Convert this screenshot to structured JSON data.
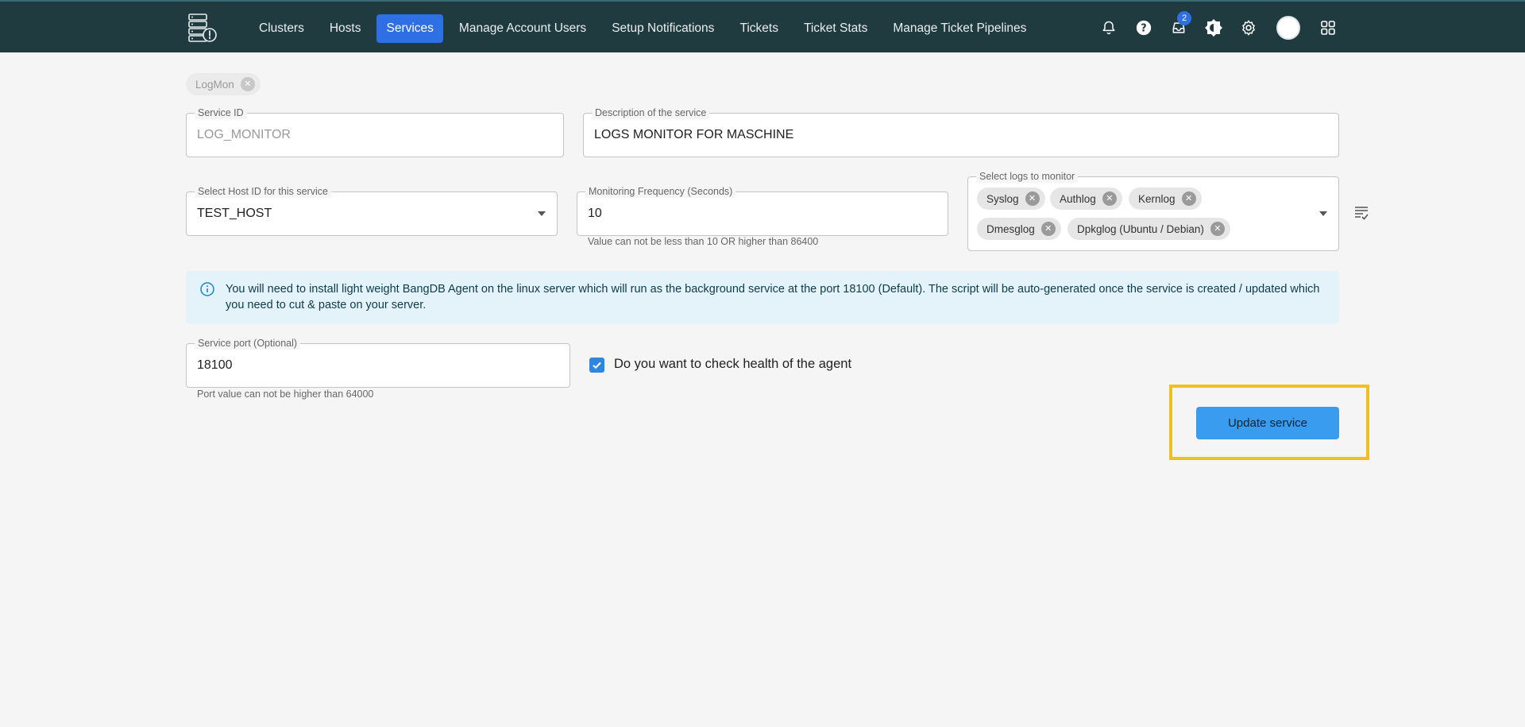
{
  "nav": {
    "items": [
      {
        "label": "Clusters"
      },
      {
        "label": "Hosts"
      },
      {
        "label": "Services"
      },
      {
        "label": "Manage Account Users"
      },
      {
        "label": "Setup Notifications"
      },
      {
        "label": "Tickets"
      },
      {
        "label": "Ticket Stats"
      },
      {
        "label": "Manage Ticket Pipelines"
      }
    ],
    "active": "Services",
    "inbox_badge": "2",
    "icons": [
      "bell-icon",
      "help-icon",
      "inbox-icon",
      "theme-icon",
      "gear-icon",
      "avatar",
      "apps-grid-icon"
    ]
  },
  "service_chip": {
    "label": "LogMon"
  },
  "form": {
    "service_id": {
      "label": "Service ID",
      "value": "LOG_MONITOR"
    },
    "description": {
      "label": "Description of the service",
      "value": "LOGS MONITOR FOR MASCHINE"
    },
    "host_id": {
      "label": "Select Host ID for this service",
      "value": "TEST_HOST"
    },
    "frequency": {
      "label": "Monitoring Frequency (Seconds)",
      "value": "10",
      "helper": "Value can not be less than 10 OR higher than 86400"
    },
    "logs": {
      "label": "Select logs to monitor",
      "selected": [
        "Syslog",
        "Authlog",
        "Kernlog",
        "Dmesglog",
        "Dpkglog (Ubuntu / Debian)"
      ]
    },
    "info_text": "You will need to install light weight BangDB Agent on the linux server which will run as the background service at the port 18100 (Default). The script will be auto-generated once the service is created / updated which you need to cut & paste on your server.",
    "port": {
      "label": "Service port (Optional)",
      "value": "18100",
      "helper": "Port value can not be higher than 64000"
    },
    "health_check": {
      "label": "Do you want to check health of the agent",
      "checked": true
    },
    "submit_label": "Update service"
  },
  "colors": {
    "topbar": "#1f3b3f",
    "active_nav": "#2f6fe6",
    "button": "#3a9cef",
    "highlight": "#f2c01e",
    "info_bg": "#e4f3fa"
  }
}
